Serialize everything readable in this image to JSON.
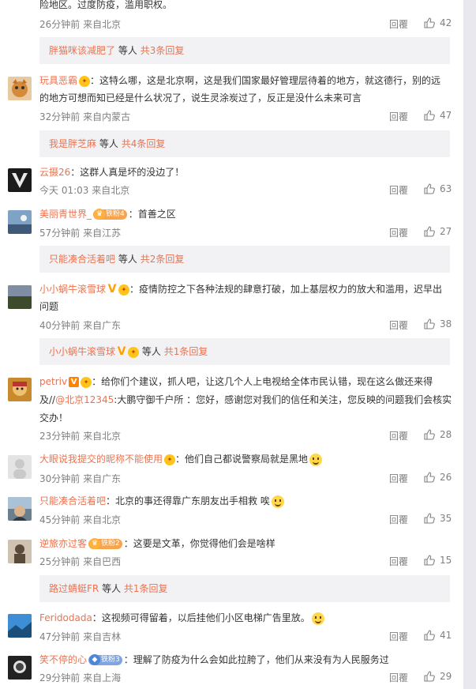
{
  "common": {
    "reply": "回覆"
  },
  "c0": {
    "text": "险地区。过度防疫，滥用职权。",
    "time": "26分钟前",
    "from": "来自北京",
    "likes": "42"
  },
  "s0": {
    "name": "胖猫咪该减肥了",
    "etc": "等人",
    "count": "共3条回复"
  },
  "c1": {
    "name": "玩具恶霸",
    "text1": "：这特么哪，这是北京啊，这是我们国家最好管理层待着的地方，就这德行，别的远",
    "text2": "的地方可想而知已经是什么状况了，说生灵涂炭过了，反正是没什么未来可言",
    "time": "32分钟前",
    "from": "来自内蒙古",
    "likes": "47"
  },
  "s1": {
    "name": "我是胖芝麻",
    "etc": "等人",
    "count": "共4条回复"
  },
  "c2": {
    "name": "云摄26",
    "text": "：这群人真是坏的没边了！",
    "time": "今天 01:03",
    "from": "来自北京",
    "likes": "63"
  },
  "c3": {
    "name": "美丽青世界_",
    "badge": "铁粉4",
    "text": "：首善之区",
    "time": "57分钟前",
    "from": "来自江苏",
    "likes": "27"
  },
  "s3": {
    "name": "只能凑合活着吧",
    "etc": "等人",
    "count": "共2条回复"
  },
  "c4": {
    "name": "小小蜗牛滚雪球",
    "text1": "：疫情防控之下各种法规的肆意打破，加上基层权力的放大和滥用，迟早出",
    "text2": "问题",
    "time": "40分钟前",
    "from": "来自广东",
    "likes": "38"
  },
  "s4": {
    "name": "小小蜗牛滚雪球",
    "etc": "等人",
    "count": "共1条回复"
  },
  "c5": {
    "name": "petriv",
    "text1": "：给你们个建议，抓人吧，让这几个人上电视给全体市民认错，现在这么做还来得",
    "text2a": "及//",
    "mention": "@北京12345",
    "text2b": ":大鹏守御千户所 ：您好，感谢您对我们的信任和关注，您反映的问题我们会核实",
    "text3": "交办！",
    "time": "23分钟前",
    "from": "来自北京",
    "likes": "28"
  },
  "c6": {
    "name": "大眼说我提交的昵称不能使用",
    "text": "：他们自己都说警察局就是黑地",
    "time": "30分钟前",
    "from": "来自广东",
    "likes": "26"
  },
  "c7": {
    "name": "只能凑合活着吧",
    "text": "：北京的事还得靠广东朋友出手相救 唉",
    "time": "45分钟前",
    "from": "来自北京",
    "likes": "35"
  },
  "c8": {
    "name": "逆旅亦过客",
    "badge": "铁粉2",
    "text": "：这要是文革，你觉得他们会是啥样",
    "time": "25分钟前",
    "from": "来自巴西",
    "likes": "15"
  },
  "s8": {
    "name": "路过蜻蜓FR",
    "etc": "等人",
    "count": "共1条回复"
  },
  "c9": {
    "name": "Feridodada",
    "text": "：这视频可得留着，以后挂他们小区电梯广告里放。",
    "time": "47分钟前",
    "from": "来自吉林",
    "likes": "41"
  },
  "c10": {
    "name": "笑不停的心",
    "badge": "铁粉3",
    "text": "：理解了防疫为什么会如此拉胯了，他们从来没有为人民服务过",
    "time": "29分钟前",
    "from": "来自上海",
    "likes": "29"
  },
  "colors": {
    "accent": "#eb7350",
    "meta": "#808080",
    "subbar": "#f2f2f5"
  }
}
